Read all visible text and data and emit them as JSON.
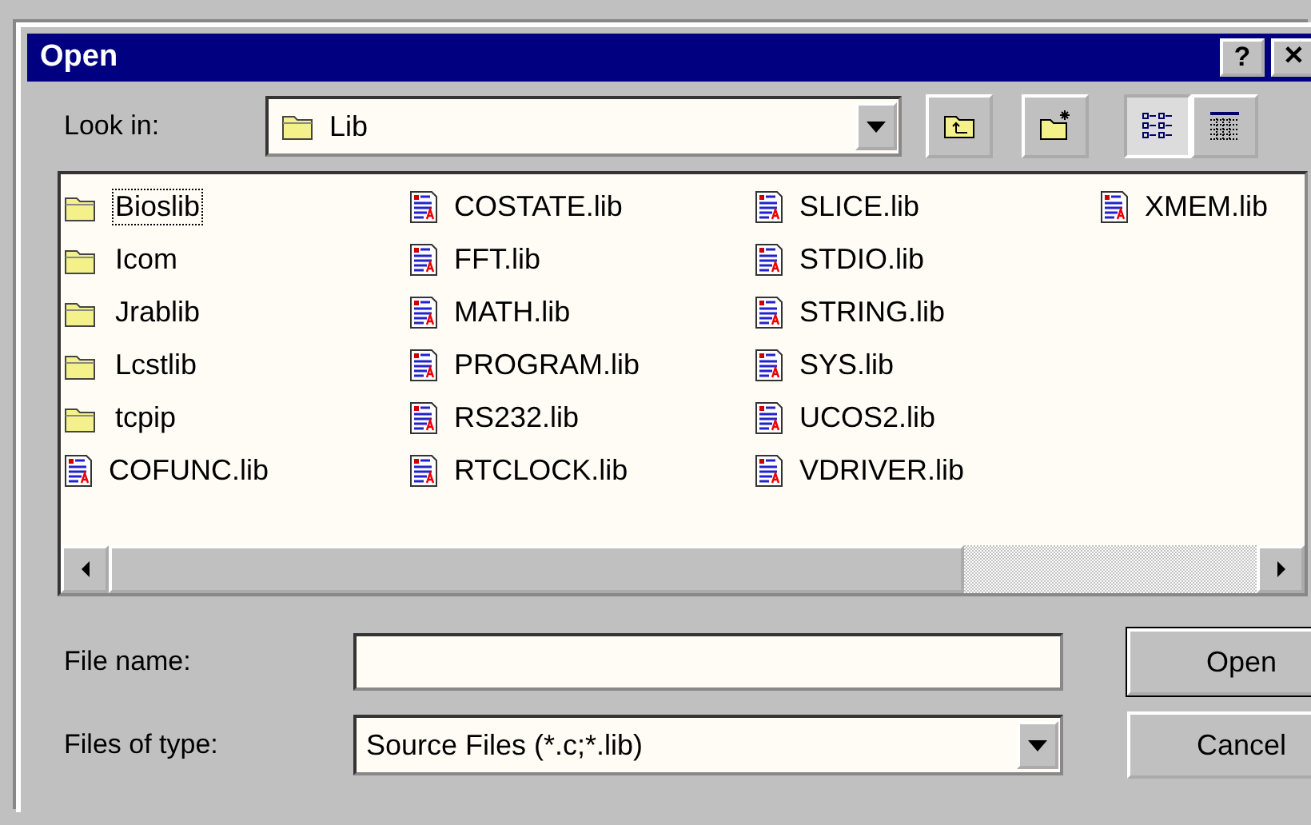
{
  "window": {
    "title": "Open",
    "title_buttons": [
      {
        "kind": "help",
        "label": "?"
      },
      {
        "kind": "close",
        "label": "✕"
      }
    ]
  },
  "look_in": {
    "label": "Look in:",
    "value": "Lib",
    "toolbar": [
      {
        "kind": "up",
        "pressed": false
      },
      {
        "kind": "new-folder",
        "pressed": false
      },
      {
        "kind": "list",
        "pressed": true
      },
      {
        "kind": "details",
        "pressed": false
      }
    ]
  },
  "files": [
    {
      "name": "Bioslib",
      "kind": "folder",
      "focused": true
    },
    {
      "name": "Icom",
      "kind": "folder",
      "focused": false
    },
    {
      "name": "Jrablib",
      "kind": "folder",
      "focused": false
    },
    {
      "name": "Lcstlib",
      "kind": "folder",
      "focused": false
    },
    {
      "name": "tcpip",
      "kind": "folder",
      "focused": false
    },
    {
      "name": "COFUNC.lib",
      "kind": "file",
      "focused": false
    },
    {
      "name": "COSTATE.lib",
      "kind": "file",
      "focused": false
    },
    {
      "name": "FFT.lib",
      "kind": "file",
      "focused": false
    },
    {
      "name": "MATH.lib",
      "kind": "file",
      "focused": false
    },
    {
      "name": "PROGRAM.lib",
      "kind": "file",
      "focused": false
    },
    {
      "name": "RS232.lib",
      "kind": "file",
      "focused": false
    },
    {
      "name": "RTCLOCK.lib",
      "kind": "file",
      "focused": false
    },
    {
      "name": "SLICE.lib",
      "kind": "file",
      "focused": false
    },
    {
      "name": "STDIO.lib",
      "kind": "file",
      "focused": false
    },
    {
      "name": "STRING.lib",
      "kind": "file",
      "focused": false
    },
    {
      "name": "SYS.lib",
      "kind": "file",
      "focused": false
    },
    {
      "name": "UCOS2.lib",
      "kind": "file",
      "focused": false
    },
    {
      "name": "VDRIVER.lib",
      "kind": "file",
      "focused": false
    },
    {
      "name": "XMEM.lib",
      "kind": "file",
      "focused": false
    }
  ],
  "file_name": {
    "label": "File name:"
  },
  "files_of_type": {
    "label": "Files of type:",
    "value": "Source Files (*.c;*.lib)"
  },
  "buttons": [
    {
      "label": "Open",
      "default": true
    },
    {
      "label": "Cancel",
      "default": false
    }
  ]
}
